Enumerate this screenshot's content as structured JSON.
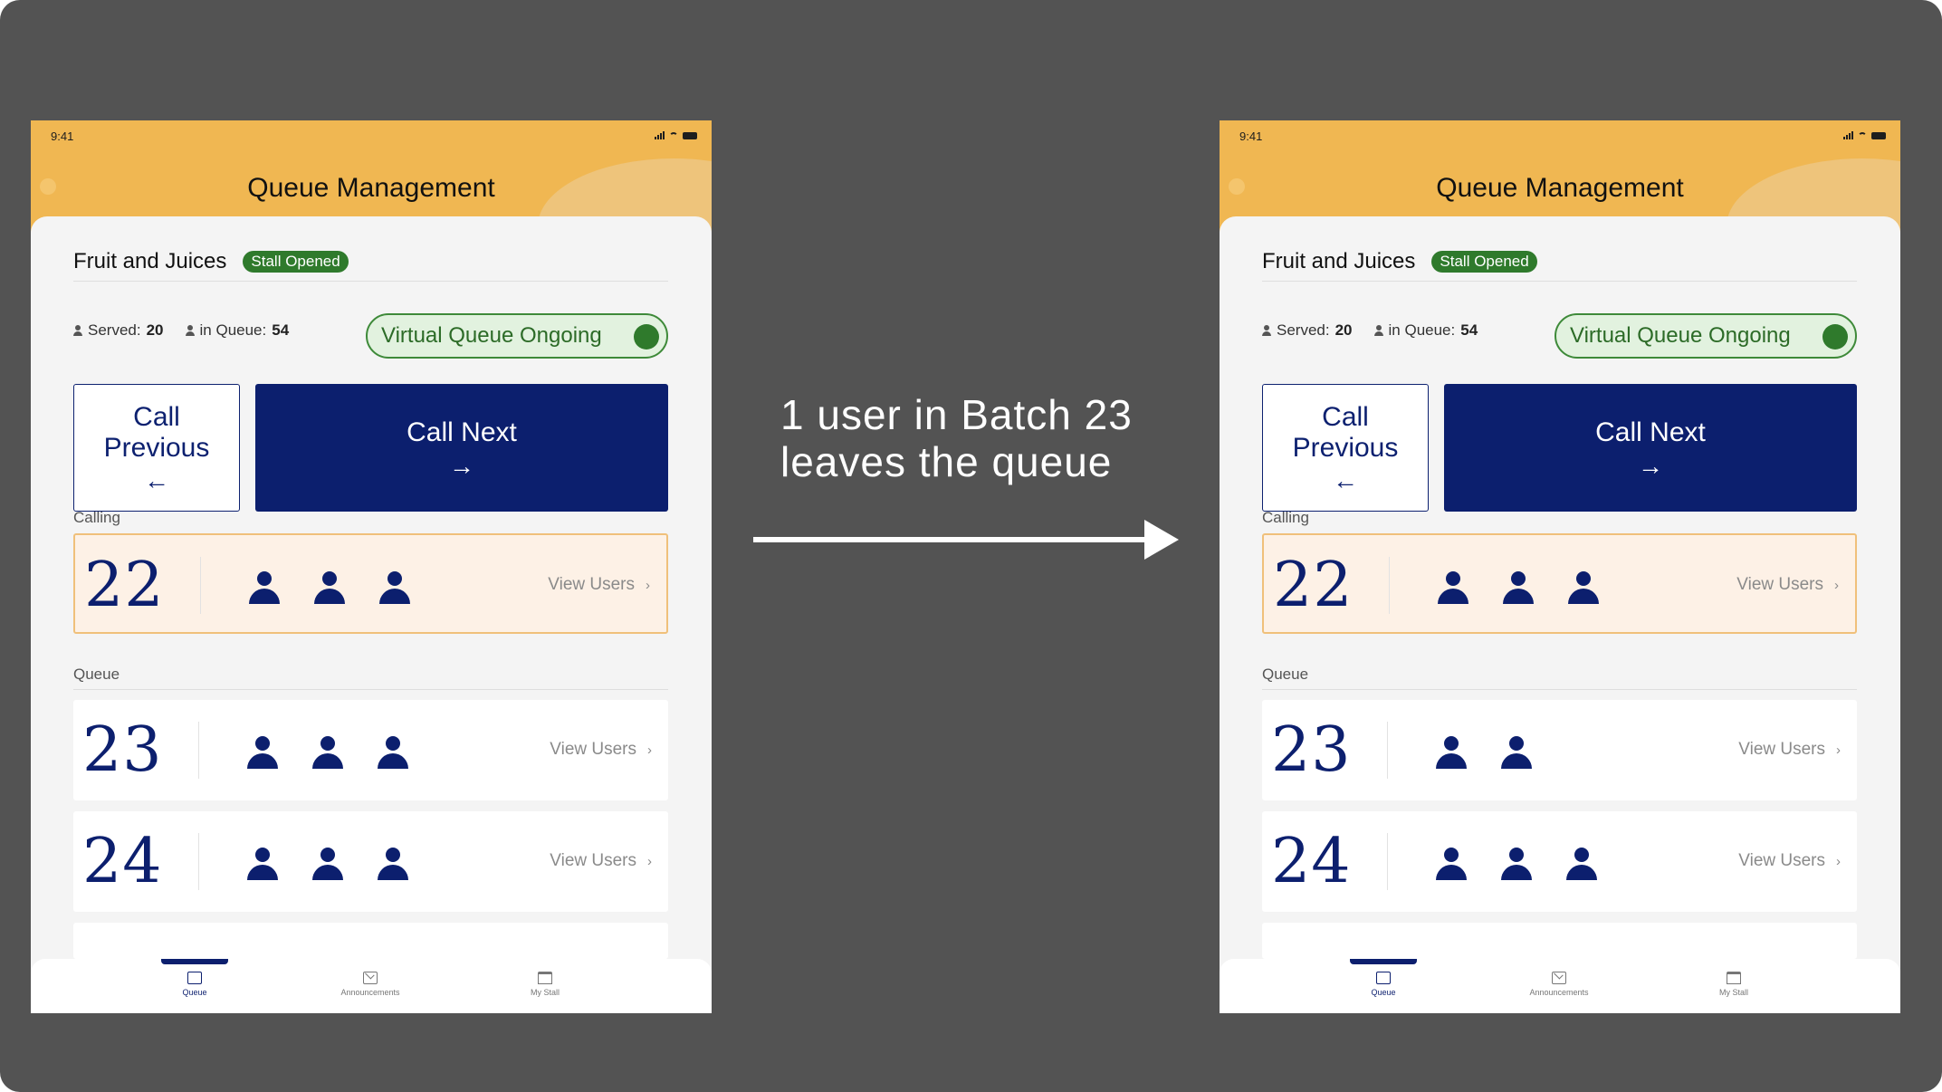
{
  "caption": {
    "line1": "1 user in Batch 23",
    "line2": "leaves the queue"
  },
  "colors": {
    "background": "#535353",
    "header": "#f0b752",
    "primary_navy": "#0c1f6e",
    "stall_green": "#2f7a2c",
    "calling_bg": "#fdf1e6"
  },
  "before": {
    "status": {
      "time": "9:41"
    },
    "header": {
      "title": "Queue Management"
    },
    "stall": {
      "name": "Fruit and Juices",
      "badge": "Stall Opened"
    },
    "stats": {
      "served_label": "Served:",
      "served": "20",
      "queue_label": "in Queue:",
      "queue": "54"
    },
    "virtual_queue": {
      "label": "Virtual Queue Ongoing",
      "on": true
    },
    "buttons": {
      "prev_line1": "Call",
      "prev_line2": "Previous",
      "prev_icon": "arrow-left-icon",
      "next": "Call Next",
      "next_icon": "arrow-right-icon"
    },
    "calling": {
      "label": "Calling",
      "batch": "22",
      "people": 3,
      "link": "View Users"
    },
    "queue": {
      "label": "Queue",
      "batches": [
        {
          "batch": "23",
          "people": 3,
          "link": "View Users"
        },
        {
          "batch": "24",
          "people": 3,
          "link": "View Users"
        }
      ]
    },
    "tabs": [
      {
        "label": "Queue",
        "icon": "queue-icon",
        "active": true
      },
      {
        "label": "Announcements",
        "icon": "mail-icon",
        "active": false
      },
      {
        "label": "My Stall",
        "icon": "store-icon",
        "active": false
      }
    ]
  },
  "after": {
    "status": {
      "time": "9:41"
    },
    "header": {
      "title": "Queue Management"
    },
    "stall": {
      "name": "Fruit and Juices",
      "badge": "Stall Opened"
    },
    "stats": {
      "served_label": "Served:",
      "served": "20",
      "queue_label": "in Queue:",
      "queue": "54"
    },
    "virtual_queue": {
      "label": "Virtual Queue Ongoing",
      "on": true
    },
    "buttons": {
      "prev_line1": "Call",
      "prev_line2": "Previous",
      "prev_icon": "arrow-left-icon",
      "next": "Call Next",
      "next_icon": "arrow-right-icon"
    },
    "calling": {
      "label": "Calling",
      "batch": "22",
      "people": 3,
      "link": "View Users"
    },
    "queue": {
      "label": "Queue",
      "batches": [
        {
          "batch": "23",
          "people": 2,
          "link": "View Users"
        },
        {
          "batch": "24",
          "people": 3,
          "link": "View Users"
        }
      ]
    },
    "tabs": [
      {
        "label": "Queue",
        "icon": "queue-icon",
        "active": true
      },
      {
        "label": "Announcements",
        "icon": "mail-icon",
        "active": false
      },
      {
        "label": "My Stall",
        "icon": "store-icon",
        "active": false
      }
    ]
  }
}
